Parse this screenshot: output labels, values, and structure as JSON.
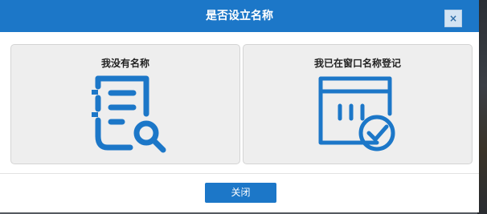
{
  "dialog": {
    "title": "是否设立名称",
    "close_glyph": "×",
    "options": [
      {
        "label": "我没有名称",
        "icon": "document-search-icon"
      },
      {
        "label": "我已在窗口名称登记",
        "icon": "calendar-check-icon"
      }
    ],
    "footer": {
      "close_label": "关闭"
    }
  },
  "colors": {
    "accent": "#1c77c8",
    "card_bg": "#eeeeee",
    "close_x_bg": "#d2e3f3"
  }
}
